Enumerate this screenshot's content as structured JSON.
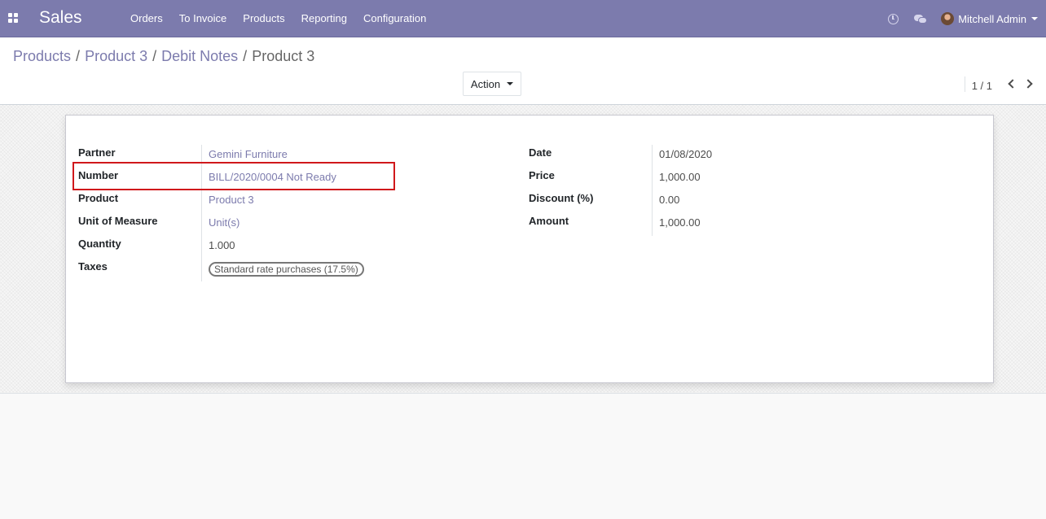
{
  "navbar": {
    "app_name": "Sales",
    "menu": [
      "Orders",
      "To Invoice",
      "Products",
      "Reporting",
      "Configuration"
    ],
    "user_name": "Mitchell Admin",
    "icons": [
      "apps-grid-icon",
      "clock-icon",
      "chat-icon",
      "user-avatar",
      "caret-down-icon"
    ]
  },
  "breadcrumb": {
    "items": [
      "Products",
      "Product 3",
      "Debit Notes"
    ],
    "separator": "/",
    "current": "Product 3"
  },
  "toolbar": {
    "action_label": "Action"
  },
  "pager": {
    "value": "1 / 1"
  },
  "form": {
    "left": [
      {
        "label": "Partner",
        "value": "Gemini Furniture",
        "link": true
      },
      {
        "label": "Number",
        "value": "BILL/2020/0004 Not Ready",
        "link": true
      },
      {
        "label": "Product",
        "value": "Product 3",
        "link": true
      },
      {
        "label": "Unit of Measure",
        "value": "Unit(s)",
        "link": true
      },
      {
        "label": "Quantity",
        "value": "1.000",
        "link": false
      },
      {
        "label": "Taxes",
        "value": "Standard rate purchases (17.5%)",
        "tag": true
      }
    ],
    "right": [
      {
        "label": "Date",
        "value": "01/08/2020"
      },
      {
        "label": "Price",
        "value": "1,000.00"
      },
      {
        "label": "Discount (%)",
        "value": "0.00"
      },
      {
        "label": "Amount",
        "value": "1,000.00"
      }
    ]
  },
  "colors": {
    "navbar": "#7c7bad",
    "link": "#7c7bad",
    "highlight": "#d0181b"
  }
}
